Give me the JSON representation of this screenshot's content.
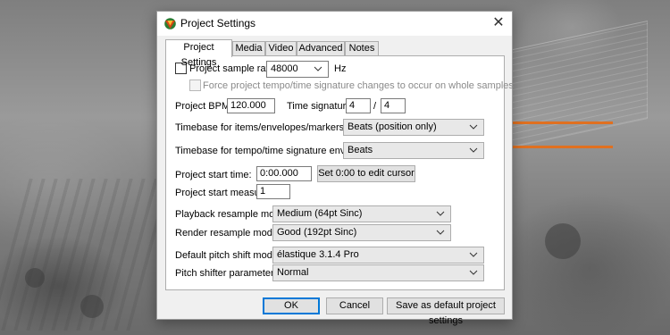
{
  "window": {
    "title": "Project Settings",
    "close_glyph": "✕",
    "app_icon": "reaper-logo-icon"
  },
  "tabs": [
    {
      "label": "Project Settings",
      "active": true
    },
    {
      "label": "Media",
      "active": false
    },
    {
      "label": "Video",
      "active": false
    },
    {
      "label": "Advanced",
      "active": false
    },
    {
      "label": "Notes",
      "active": false
    }
  ],
  "sample_rate": {
    "label": "Project sample rate:",
    "checked": false,
    "value": "48000",
    "unit": "Hz"
  },
  "force_tempo": {
    "label": "Force project tempo/time signature changes to occur on whole samples",
    "checked": false,
    "enabled": false
  },
  "bpm": {
    "label": "Project BPM:",
    "value": "120.000"
  },
  "time_signature": {
    "label": "Time signature",
    "numerator": "4",
    "separator": "/",
    "denominator": "4"
  },
  "timebase_items": {
    "label": "Timebase for items/envelopes/markers:",
    "value": "Beats (position only)"
  },
  "timebase_tempo": {
    "label": "Timebase for tempo/time signature envelope:",
    "value": "Beats"
  },
  "start_time": {
    "label": "Project start time:",
    "value": "0:00.000",
    "button": "Set 0:00 to edit cursor"
  },
  "start_measure": {
    "label": "Project start measure:",
    "value": "1"
  },
  "playback_resample": {
    "label": "Playback resample mode:",
    "value": "Medium (64pt Sinc)"
  },
  "render_resample": {
    "label": "Render resample mode:",
    "value": "Good (192pt Sinc)"
  },
  "pitch_shift": {
    "label": "Default pitch shift mode:",
    "value": "élastique 3.1.4 Pro"
  },
  "pitch_param": {
    "label": "Pitch shifter parameter:",
    "value": "Normal"
  },
  "buttons": {
    "ok": "OK",
    "cancel": "Cancel",
    "save_default": "Save as default project settings"
  },
  "colors": {
    "annotation_arrow": "#e07020",
    "dialog_bg": "#f0f0f0",
    "accent": "#0078d7"
  }
}
